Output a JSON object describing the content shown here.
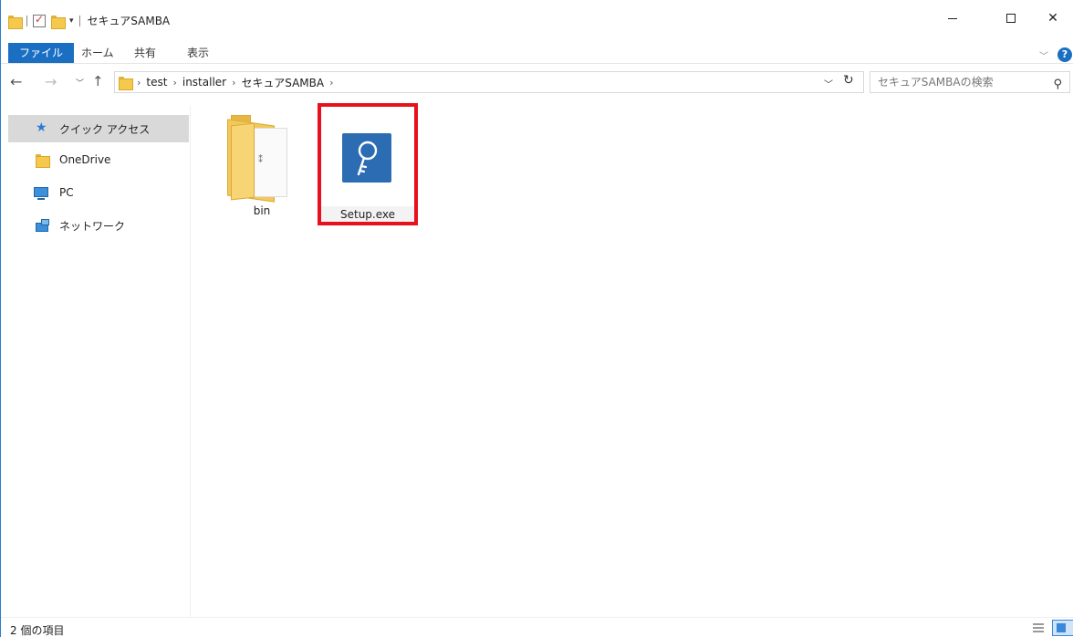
{
  "window": {
    "title": "セキュアSAMBA",
    "qat_dropdown": "▾"
  },
  "ribbon": {
    "tabs": [
      {
        "label": "ファイル",
        "active": true
      },
      {
        "label": "ホーム"
      },
      {
        "label": "共有"
      },
      {
        "label": "表示"
      }
    ],
    "help": "?"
  },
  "address": {
    "breadcrumbs": [
      "test",
      "installer",
      "セキュアSAMBA"
    ],
    "search_placeholder": "セキュアSAMBAの検索"
  },
  "sidebar": {
    "items": [
      {
        "label": "クイック アクセス",
        "icon": "star-icon",
        "selected": true
      },
      {
        "label": "OneDrive",
        "icon": "folder-icon"
      },
      {
        "label": "PC",
        "icon": "computer-icon"
      },
      {
        "label": "ネットワーク",
        "icon": "network-icon"
      }
    ]
  },
  "files": [
    {
      "name": "bin",
      "type": "folder"
    },
    {
      "name": "Setup.exe",
      "type": "application",
      "highlighted": true
    }
  ],
  "status": {
    "item_count": "2 個の項目"
  },
  "colors": {
    "accent": "#1a6fc3",
    "highlight_border": "#e8101c",
    "app_icon_bg": "#2b6cb3",
    "folder": "#f5c94d"
  }
}
